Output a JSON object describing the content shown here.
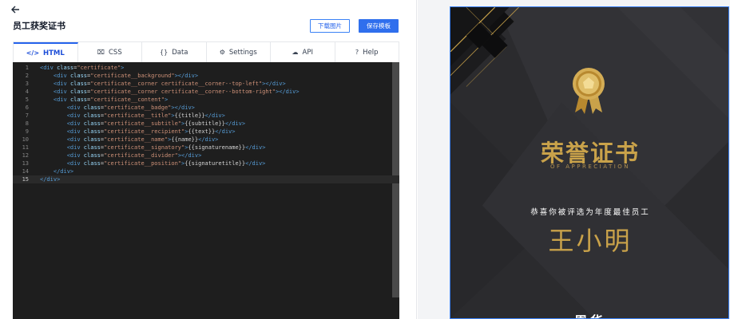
{
  "header": {
    "back_icon": "arrow-left-icon",
    "title": "员工获奖证书",
    "download_label": "下载图片",
    "save_label": "保存模板"
  },
  "tabs": [
    {
      "label": "HTML",
      "icon": "code-icon",
      "glyph": "</>",
      "active": true
    },
    {
      "label": "CSS",
      "icon": "css3-icon",
      "glyph": "⌧",
      "active": false
    },
    {
      "label": "Data",
      "icon": "braces-icon",
      "glyph": "{}",
      "active": false
    },
    {
      "label": "Settings",
      "icon": "gear-icon",
      "glyph": "⚙",
      "active": false
    },
    {
      "label": "API",
      "icon": "cloud-icon",
      "glyph": "☁",
      "active": false
    },
    {
      "label": "Help",
      "icon": "help-icon",
      "glyph": "?",
      "active": false
    }
  ],
  "editor": {
    "current_line": 15,
    "lines": [
      {
        "n": "1",
        "indent": "",
        "parts": [
          [
            "tag",
            "<div "
          ],
          [
            "attr",
            "class"
          ],
          [
            "txt",
            "="
          ],
          [
            "str",
            "\"certificate\""
          ],
          [
            "tag",
            ">"
          ]
        ]
      },
      {
        "n": "2",
        "indent": "    ",
        "parts": [
          [
            "tag",
            "<div "
          ],
          [
            "attr",
            "class"
          ],
          [
            "txt",
            "="
          ],
          [
            "str",
            "\"certificate__background\""
          ],
          [
            "tag",
            "></div>"
          ]
        ]
      },
      {
        "n": "3",
        "indent": "    ",
        "parts": [
          [
            "tag",
            "<div "
          ],
          [
            "attr",
            "class"
          ],
          [
            "txt",
            "="
          ],
          [
            "str",
            "\"certificate__corner certificate__corner--top-left\""
          ],
          [
            "tag",
            "></div>"
          ]
        ]
      },
      {
        "n": "4",
        "indent": "    ",
        "parts": [
          [
            "tag",
            "<div "
          ],
          [
            "attr",
            "class"
          ],
          [
            "txt",
            "="
          ],
          [
            "str",
            "\"certificate__corner certificate__corner--bottom-right\""
          ],
          [
            "tag",
            "></div>"
          ]
        ]
      },
      {
        "n": "5",
        "indent": "    ",
        "parts": [
          [
            "tag",
            "<div "
          ],
          [
            "attr",
            "class"
          ],
          [
            "txt",
            "="
          ],
          [
            "str",
            "\"certificate__content\""
          ],
          [
            "tag",
            ">"
          ]
        ]
      },
      {
        "n": "6",
        "indent": "        ",
        "parts": [
          [
            "tag",
            "<div "
          ],
          [
            "attr",
            "class"
          ],
          [
            "txt",
            "="
          ],
          [
            "str",
            "\"certificate__badge\""
          ],
          [
            "tag",
            "></div>"
          ]
        ]
      },
      {
        "n": "7",
        "indent": "        ",
        "parts": [
          [
            "tag",
            "<div "
          ],
          [
            "attr",
            "class"
          ],
          [
            "txt",
            "="
          ],
          [
            "str",
            "\"certificate__title\""
          ],
          [
            "tag",
            ">"
          ],
          [
            "txt",
            "{{title}}"
          ],
          [
            "tag",
            "</div>"
          ]
        ]
      },
      {
        "n": "8",
        "indent": "        ",
        "parts": [
          [
            "tag",
            "<div "
          ],
          [
            "attr",
            "class"
          ],
          [
            "txt",
            "="
          ],
          [
            "str",
            "\"certificate__subtitle\""
          ],
          [
            "tag",
            ">"
          ],
          [
            "txt",
            "{{subtitle}}"
          ],
          [
            "tag",
            "</div>"
          ]
        ]
      },
      {
        "n": "9",
        "indent": "        ",
        "parts": [
          [
            "tag",
            "<div "
          ],
          [
            "attr",
            "class"
          ],
          [
            "txt",
            "="
          ],
          [
            "str",
            "\"certificate__recipient\""
          ],
          [
            "tag",
            ">"
          ],
          [
            "txt",
            "{{text}}"
          ],
          [
            "tag",
            "</div>"
          ]
        ]
      },
      {
        "n": "10",
        "indent": "        ",
        "parts": [
          [
            "tag",
            "<div "
          ],
          [
            "attr",
            "class"
          ],
          [
            "txt",
            "="
          ],
          [
            "str",
            "\"certificate__name\""
          ],
          [
            "tag",
            ">"
          ],
          [
            "txt",
            "{{name}}"
          ],
          [
            "tag",
            "</div>"
          ]
        ]
      },
      {
        "n": "11",
        "indent": "        ",
        "parts": [
          [
            "tag",
            "<div "
          ],
          [
            "attr",
            "class"
          ],
          [
            "txt",
            "="
          ],
          [
            "str",
            "\"certificate__signatory\""
          ],
          [
            "tag",
            ">"
          ],
          [
            "txt",
            "{{signaturename}}"
          ],
          [
            "tag",
            "</div>"
          ]
        ]
      },
      {
        "n": "12",
        "indent": "        ",
        "parts": [
          [
            "tag",
            "<div "
          ],
          [
            "attr",
            "class"
          ],
          [
            "txt",
            "="
          ],
          [
            "str",
            "\"certificate__divider\""
          ],
          [
            "tag",
            "></div>"
          ]
        ]
      },
      {
        "n": "13",
        "indent": "        ",
        "parts": [
          [
            "tag",
            "<div "
          ],
          [
            "attr",
            "class"
          ],
          [
            "txt",
            "="
          ],
          [
            "str",
            "\"certificate__position\""
          ],
          [
            "tag",
            ">"
          ],
          [
            "txt",
            "{{signaturetitle}}"
          ],
          [
            "tag",
            "</div>"
          ]
        ]
      },
      {
        "n": "14",
        "indent": "    ",
        "parts": [
          [
            "tag",
            "</div>"
          ]
        ]
      },
      {
        "n": "15",
        "indent": "",
        "parts": [
          [
            "tag",
            "</div>"
          ]
        ]
      }
    ]
  },
  "preview": {
    "badge_icon": "gold-medal-icon",
    "title": "荣誉证书",
    "subtitle": "OF APPRECIATION",
    "recipient_text": "恭喜你被评选为年度最佳员工",
    "name": "王小明",
    "signatory": "周华",
    "colors": {
      "background": "#2b2b2e",
      "gold": "#c9a24a",
      "accent": "#2f6fed"
    }
  }
}
